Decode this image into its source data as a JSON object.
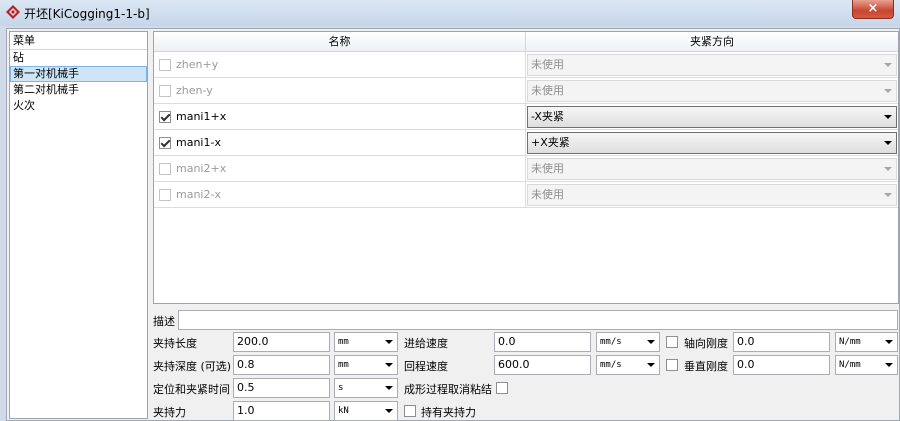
{
  "window": {
    "title": "开坯[KiCogging1-1-b]",
    "close_label": "×"
  },
  "sidebar": {
    "header": "菜单",
    "items": [
      {
        "label": "砧",
        "selected": false
      },
      {
        "label": "第一对机械手",
        "selected": true
      },
      {
        "label": "第二对机械手",
        "selected": false
      },
      {
        "label": "火次",
        "selected": false
      }
    ]
  },
  "table": {
    "col_name": "名称",
    "col_clamp": "夹紧方向",
    "rows": [
      {
        "name": "zhen+y",
        "checked": false,
        "enabled": false,
        "clamp": "未使用"
      },
      {
        "name": "zhen-y",
        "checked": false,
        "enabled": false,
        "clamp": "未使用"
      },
      {
        "name": "mani1+x",
        "checked": true,
        "enabled": true,
        "clamp": "-X夹紧"
      },
      {
        "name": "mani1-x",
        "checked": true,
        "enabled": true,
        "clamp": "+X夹紧"
      },
      {
        "name": "mani2+x",
        "checked": false,
        "enabled": false,
        "clamp": "未使用"
      },
      {
        "name": "mani2-x",
        "checked": false,
        "enabled": false,
        "clamp": "未使用"
      }
    ]
  },
  "form": {
    "description_label": "描述",
    "description_value": "",
    "grip_length_label": "夹持长度",
    "grip_length_value": "200.0",
    "grip_length_unit": "mm",
    "feed_speed_label": "进给速度",
    "feed_speed_value": "0.0",
    "feed_speed_unit": "mm/s",
    "axial_stiffness_label": "轴向刚度",
    "axial_stiffness_value": "0.0",
    "axial_stiffness_unit": "N/mm",
    "grip_depth_label": "夹持深度 (可选)",
    "grip_depth_value": "0.8",
    "grip_depth_unit": "mm",
    "return_speed_label": "回程速度",
    "return_speed_value": "600.0",
    "return_speed_unit": "mm/s",
    "vertical_stiffness_label": "垂直刚度",
    "vertical_stiffness_value": "0.0",
    "vertical_stiffness_unit": "N/mm",
    "position_time_label": "定位和夹紧时间",
    "position_time_value": "0.5",
    "position_time_unit": "s",
    "cancel_adhesion_label": "成形过程取消粘结",
    "grip_force_label": "夹持力",
    "grip_force_value": "1.0",
    "grip_force_unit": "kN",
    "hold_force_label": "持有夹持力"
  },
  "colors": {
    "title_bar": "#c6d6e8",
    "selection": "#cde5f7",
    "close_button": "#c7452f"
  },
  "icons": {
    "app": "app-logo-icon",
    "dropdown": "chevron-down-icon"
  }
}
